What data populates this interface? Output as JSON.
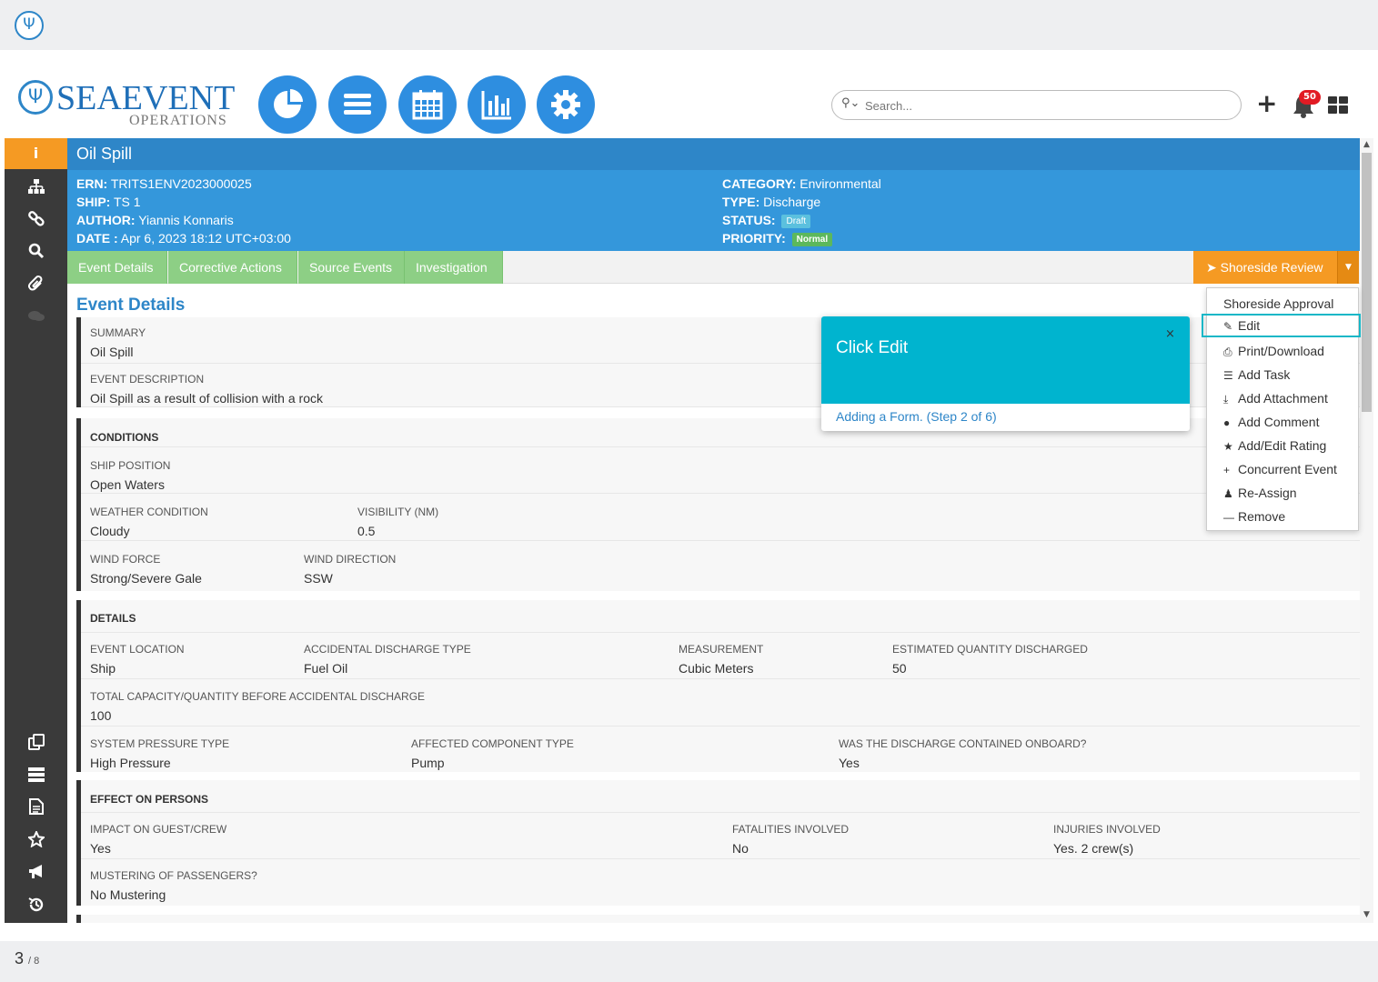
{
  "app": {
    "brand_name": "SEAEVENT",
    "brand_sub": "OPERATIONS"
  },
  "search": {
    "placeholder": "Search..."
  },
  "notifications": {
    "count": "50"
  },
  "event": {
    "title": "Oil Spill",
    "ern_label": "ERN:",
    "ern": "TRITS1ENV2023000025",
    "ship_label": "SHIP:",
    "ship": "TS 1",
    "author_label": "AUTHOR:",
    "author": "Yiannis Konnaris",
    "date_label": "DATE :",
    "date": "Apr 6, 2023 18:12 UTC+03:00",
    "category_label": "CATEGORY:",
    "category": "Environmental",
    "type_label": "TYPE:",
    "type": "Discharge",
    "status_label": "STATUS:",
    "status": "Draft",
    "priority_label": "PRIORITY:",
    "priority": "Normal"
  },
  "tabs": [
    "Event Details",
    "Corrective Actions",
    "Source Events",
    "Investigation"
  ],
  "review_button": "Shoreside Review",
  "section_title": "Event Details",
  "summary": {
    "summary_label": "SUMMARY",
    "summary": "Oil Spill",
    "description_label": "EVENT DESCRIPTION",
    "description": "Oil Spill as a result of collision with a rock"
  },
  "conditions": {
    "title": "CONDITIONS",
    "ship_position_label": "SHIP POSITION",
    "ship_position": "Open Waters",
    "weather_label": "WEATHER CONDITION",
    "weather": "Cloudy",
    "visibility_label": "VISIBILITY (NM)",
    "visibility": "0.5",
    "wind_force_label": "WIND FORCE",
    "wind_force": "Strong/Severe Gale",
    "wind_direction_label": "WIND DIRECTION",
    "wind_direction": "SSW"
  },
  "details": {
    "title": "DETAILS",
    "location_label": "EVENT LOCATION",
    "location": "Ship",
    "discharge_type_label": "ACCIDENTAL DISCHARGE TYPE",
    "discharge_type": "Fuel Oil",
    "measurement_label": "MEASUREMENT",
    "measurement": "Cubic Meters",
    "estimated_label": "ESTIMATED QUANTITY DISCHARGED",
    "estimated": "50",
    "capacity_label": "TOTAL CAPACITY/QUANTITY BEFORE ACCIDENTAL DISCHARGE",
    "capacity": "100",
    "pressure_label": "SYSTEM PRESSURE TYPE",
    "pressure": "High Pressure",
    "component_label": "AFFECTED COMPONENT TYPE",
    "component": "Pump",
    "contained_label": "WAS THE DISCHARGE CONTAINED ONBOARD?",
    "contained": "Yes"
  },
  "effect": {
    "title": "EFFECT ON PERSONS",
    "impact_label": "IMPACT ON GUEST/CREW",
    "impact": "Yes",
    "fatalities_label": "FATALITIES INVOLVED",
    "fatalities": "No",
    "injuries_label": "INJURIES INVOLVED",
    "injuries": "Yes. 2 crew(s)",
    "mustering_label": "MUSTERING OF PASSENGERS?",
    "mustering": "No Mustering"
  },
  "dropdown": {
    "items": [
      {
        "label": "Shoreside Approval",
        "icon": ""
      },
      {
        "label": "Edit",
        "icon": "edit-icon"
      },
      {
        "label": "Print/Download",
        "icon": "print-icon"
      },
      {
        "label": "Add Task",
        "icon": "list-icon"
      },
      {
        "label": "Add Attachment",
        "icon": "upload-icon"
      },
      {
        "label": "Add Comment",
        "icon": "comment-icon"
      },
      {
        "label": "Add/Edit Rating",
        "icon": "star-icon"
      },
      {
        "label": "Concurrent Event",
        "icon": "plus-icon"
      },
      {
        "label": "Re-Assign",
        "icon": "user-icon"
      },
      {
        "label": "Remove",
        "icon": "minus-icon"
      }
    ]
  },
  "tour": {
    "title": "Click Edit",
    "close": "×",
    "step": "Adding a Form. (Step 2 of 6)"
  },
  "footer": {
    "page": "3",
    "total": "/ 8"
  },
  "colors": {
    "primary": "#2e86c8",
    "accent": "#f59a23",
    "tab": "#8dcf85",
    "tour": "#00b4cf"
  }
}
